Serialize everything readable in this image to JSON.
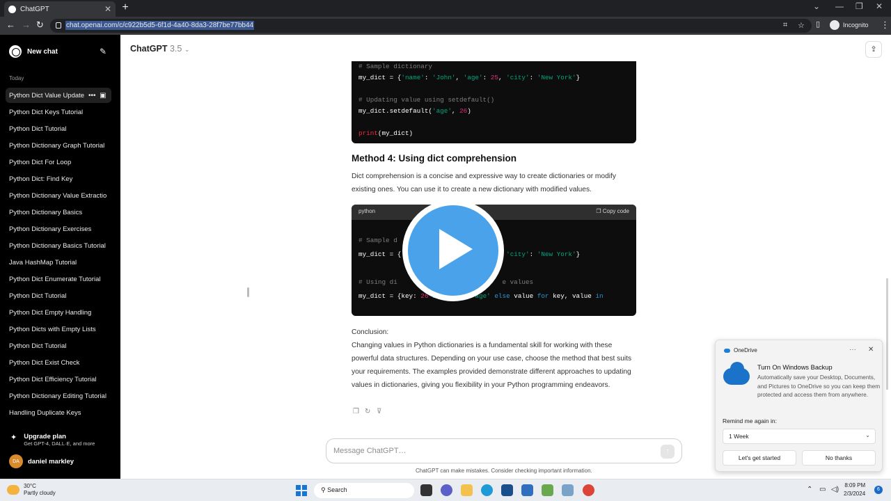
{
  "browser": {
    "tab_title": "ChatGPT",
    "url": "chat.openai.com/c/c922b5d5-6f1d-4a40-8da3-28f7be77bb44",
    "incognito_label": "Incognito"
  },
  "sidebar": {
    "new_chat": "New chat",
    "section_label": "Today",
    "items": [
      "Python Dict Value Update",
      "Python Dict Keys Tutorial",
      "Python Dict Tutorial",
      "Python Dictionary Graph Tutorial",
      "Python Dict For Loop",
      "Python Dict: Find Key",
      "Python Dictionary Value Extraction",
      "Python Dictionary Basics",
      "Python Dictionary Exercises",
      "Python Dictionary Basics Tutorial",
      "Java HashMap Tutorial",
      "Python Dict Enumerate Tutorial",
      "Python Dict Tutorial",
      "Python Dict Empty Handling",
      "Python Dicts with Empty Lists",
      "Python Dict Tutorial",
      "Python Dict Exist Check",
      "Python Dict Efficiency Tutorial",
      "Python Dictionary Editing Tutorial",
      "Handling Duplicate Keys"
    ],
    "upgrade_title": "Upgrade plan",
    "upgrade_sub": "Get GPT-4, DALL·E, and more",
    "user_initials": "DA",
    "user_name": "daniel markley"
  },
  "main": {
    "model_name": "ChatGPT",
    "model_version": "3.5",
    "code1_comment1": "# Sample dictionary",
    "code1_comment2": "# Updating value using setdefault()",
    "method4_heading": "Method 4: Using dict comprehension",
    "method4_text": "Dict comprehension is a concise and expressive way to create dictionaries or modify existing ones. You can use it to create a new dictionary with modified values.",
    "code2_lang": "python",
    "copy_label": "Copy code",
    "code2_comment1": "# Sample d",
    "code2_comment2": "# Using di",
    "code2_comment2_tail": "e values",
    "conclusion_label": "Conclusion:",
    "conclusion_text": "Changing values in Python dictionaries is a fundamental skill for working with these powerful data structures. Depending on your use case, choose the method that best suits your requirements. The examples provided demonstrate different approaches to updating values in dictionaries, giving you flexibility in your Python programming endeavors.",
    "composer_placeholder": "Message ChatGPT…",
    "disclaimer": "ChatGPT can make mistakes. Consider checking important information."
  },
  "onedrive": {
    "app": "OneDrive",
    "title": "Turn On Windows Backup",
    "body": "Automatically save your Desktop, Documents, and Pictures to OneDrive so you can keep them protected and access them from anywhere.",
    "remind_label": "Remind me again in:",
    "remind_value": "1 Week",
    "primary_button": "Let's get started",
    "secondary_button": "No thanks"
  },
  "taskbar": {
    "temperature": "30°C",
    "weather": "Partly cloudy",
    "search_label": "Search",
    "time": "8:09 PM",
    "date": "2/3/2024",
    "notification_count": "6"
  },
  "colors": {
    "sidebar_bg": "#000000",
    "play_button": "#4aa3ea",
    "code_bg": "#0d0d0d",
    "string_green": "#00a67d",
    "number_pink": "#df3079"
  }
}
